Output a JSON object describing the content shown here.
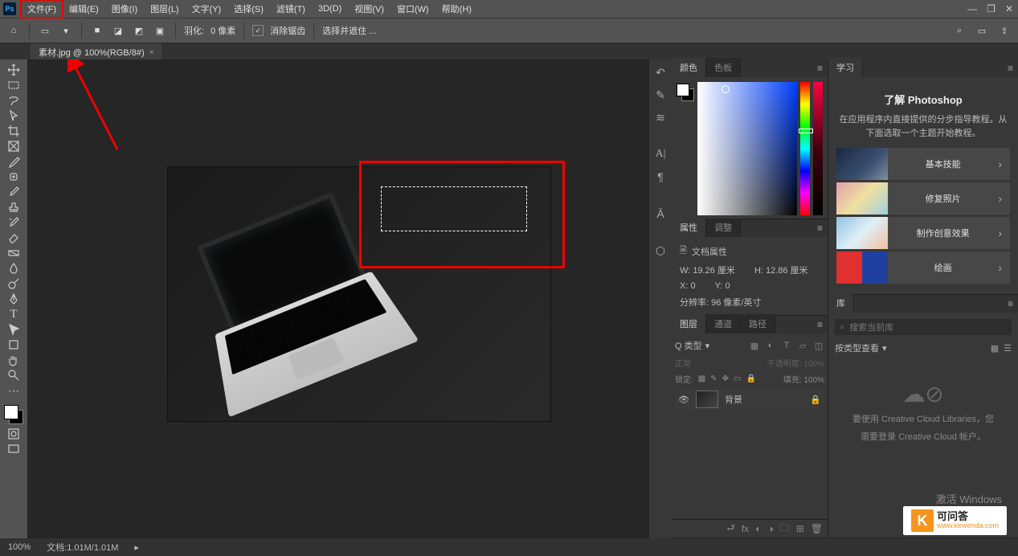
{
  "menubar": {
    "items": [
      "文件(F)",
      "编辑(E)",
      "图像(I)",
      "图层(L)",
      "文字(Y)",
      "选择(S)",
      "滤镜(T)",
      "3D(D)",
      "视图(V)",
      "窗口(W)",
      "帮助(H)"
    ],
    "highlighted_index": 0
  },
  "options_bar": {
    "feather_label": "羽化:",
    "feather_value": "0 像素",
    "antialias_label": "消除锯齿",
    "style_label": "选择并遮住 ..."
  },
  "document_tab": {
    "title": "素材.jpg @ 100%(RGB/8#)",
    "close": "×"
  },
  "panels": {
    "color_tab": "颜色",
    "swatches_tab": "色板",
    "properties_tab": "属性",
    "adjustments_tab": "调整",
    "learn_tab": "学习",
    "libraries_tab": "库",
    "layers_tab": "图层",
    "channels_tab": "通道",
    "paths_tab": "路径"
  },
  "properties": {
    "header": "文档属性",
    "w_label": "W:",
    "w_value": "19.26 厘米",
    "h_label": "H:",
    "h_value": "12.86 厘米",
    "x_label": "X:",
    "x_value": "0",
    "y_label": "Y:",
    "y_value": "0",
    "res_label": "分辨率:",
    "res_value": "96 像素/英寸"
  },
  "learn": {
    "title": "了解 Photoshop",
    "subtitle": "在应用程序内直接提供的分步指导教程。从下面选取一个主题开始教程。",
    "tutorials": [
      "基本技能",
      "修复照片",
      "制作创意效果",
      "绘画"
    ]
  },
  "libraries": {
    "search_placeholder": "搜索当前库",
    "filter_label": "按类型查看",
    "empty_line1": "要使用 Creative Cloud Libraries，您",
    "empty_line2": "需要登录 Creative Cloud 帐户。"
  },
  "layers": {
    "kind_label": "Q 类型",
    "mode_label": "正常",
    "opacity_label": "不透明度:",
    "opacity_value": "100%",
    "lock_label": "锁定:",
    "fill_label": "填充:",
    "fill_value": "100%",
    "layer_name": "背景"
  },
  "statusbar": {
    "zoom": "100%",
    "doc_info": "文档:1.01M/1.01M"
  },
  "activate_text": "激活 Windows",
  "watermark": {
    "brand": "可问答",
    "url": "www.kewenda.com"
  },
  "icons": {
    "search": "⌕",
    "panel": "▭",
    "share": "⇪",
    "home": "⌂",
    "min": "—",
    "max": "❐",
    "close": "✕",
    "doc": "🗎",
    "eye": "👁",
    "lock": "🔒",
    "cloud": "☁︎⊘",
    "chevron": "›",
    "caret": "▾",
    "menu": "≡",
    "grid": "▦",
    "list": "☰",
    "link": "⮐",
    "fx": "fx",
    "mask": "◐",
    "folder": "🗀",
    "new": "⊞",
    "trash": "🗑",
    "adj": "◑"
  }
}
